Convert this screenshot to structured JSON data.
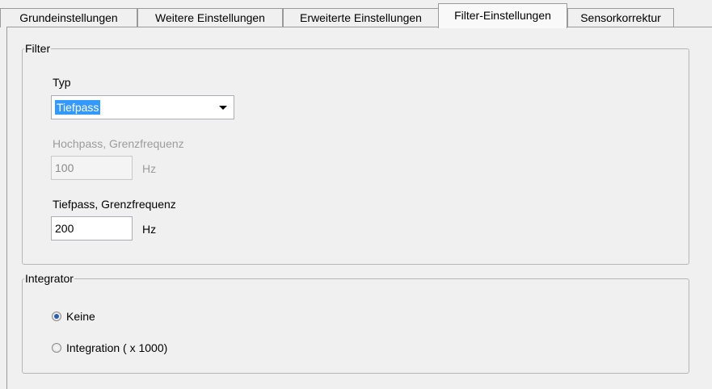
{
  "tabs": [
    {
      "label": "Grundeinstellungen",
      "active": false
    },
    {
      "label": "Weitere Einstellungen",
      "active": false
    },
    {
      "label": "Erweiterte Einstellungen",
      "active": false
    },
    {
      "label": "Filter-Einstellungen",
      "active": true
    },
    {
      "label": "Sensorkorrektur",
      "active": false
    }
  ],
  "filter": {
    "group_title": "Filter",
    "type_label": "Typ",
    "type_value": "Tiefpass",
    "highpass_label": "Hochpass, Grenzfrequenz",
    "highpass_value": "100",
    "highpass_unit": "Hz",
    "highpass_enabled": false,
    "lowpass_label": "Tiefpass, Grenzfrequenz",
    "lowpass_value": "200",
    "lowpass_unit": "Hz"
  },
  "integrator": {
    "group_title": "Integrator",
    "options": [
      {
        "label": "Keine",
        "checked": true
      },
      {
        "label": "Integration ( x 1000)",
        "checked": false
      }
    ]
  },
  "colors": {
    "selection": "#3399ff",
    "disabled_text": "#9c9c9c"
  },
  "icons": {
    "combo_arrow": "chevron-down-icon",
    "radio_selected": "radio-selected-icon",
    "radio_unselected": "radio-unselected-icon"
  }
}
